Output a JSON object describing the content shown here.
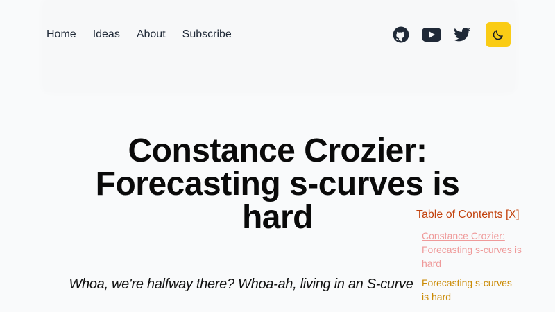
{
  "nav": {
    "items": [
      "Home",
      "Ideas",
      "About",
      "Subscribe"
    ]
  },
  "social": {
    "icons": [
      "github-icon",
      "youtube-icon",
      "twitter-icon",
      "moon-icon"
    ]
  },
  "colors": {
    "accent_button": "#facc15",
    "toc_heading": "#c2410c",
    "toc_link_visited": "#ef9a9a",
    "toc_link_active": "#ca8a04"
  },
  "article": {
    "title": "Constance Crozier: Forecasting s-curves is hard",
    "subtitle": "Whoa, we're halfway there? Whoa-ah, living in an S-curve"
  },
  "toc": {
    "heading": "Table of Contents [X]",
    "items": [
      "Constance Crozier: Forecasting s-curves is hard",
      "Forecasting s-curves is hard"
    ]
  }
}
